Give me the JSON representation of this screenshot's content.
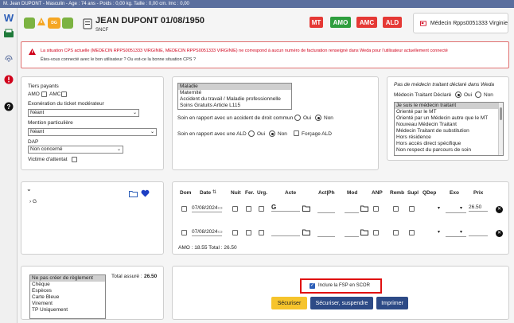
{
  "topbar": {
    "text": "M. Jean DUPONT - Masculin - Age : 74 ans -   Poids : 0,00 kg.  Taille : 0,00 cm.  Imc : 0,00"
  },
  "sidebar": {
    "items": [
      "w-logo-icon",
      "card-reader-icon",
      "fingerprint-icon",
      "alert-icon",
      "help-icon"
    ]
  },
  "patient": {
    "name": "JEAN DUPONT 01/08/1950",
    "org": "SNCF"
  },
  "badges": [
    {
      "label": "MT",
      "color": "#e53935"
    },
    {
      "label": "AMO",
      "color": "#2e9e3e"
    },
    {
      "label": "AMC",
      "color": "#e53935"
    },
    {
      "label": "ALD",
      "color": "#e53935"
    }
  ],
  "doctor": {
    "label": "Médecin Rpps0051333 Virginie"
  },
  "alert": {
    "title": "La situation CPS actuelle (MEDECIN RPPS0051333 VIRGINIE, MEDECIN RPPS0051333 VIRGINIE) ne correspond à aucun numéro de facturation renseigné dans Weda pour l'utilisateur actuellement connecté",
    "sub": "Êtes-vous connecté avec le bon utilisateur ? Ou est-ce la bonne situation CPS ?"
  },
  "left_panel": {
    "tiers_payants": "Tiers payants",
    "amo": "AMO",
    "amc": "AMC",
    "exoneration_label": "Exonération du ticket modérateur",
    "exoneration_value": "Néant",
    "mention_label": "Mention particulière",
    "mention_value": "Néant",
    "dap_label": "DAP",
    "dap_value": "Non concerné",
    "victime_label": "Victime d'attentat"
  },
  "middle_panel": {
    "list": [
      "Maladie",
      "Maternité",
      "Accident du travail / Maladie professionnelle",
      "Soins Gratuits Article L115"
    ],
    "accident_label": "Soin en rapport avec un accident de droit commun",
    "ald_label": "Soin en rapport avec une ALD",
    "oui": "Oui",
    "non": "Non",
    "forcage": "Forçage ALD"
  },
  "right_panel": {
    "title": "Pas de médecin traitant déclaré dans Weda",
    "declare_label": "Médecin Traitant Déclaré",
    "oui": "Oui",
    "non": "Non",
    "list": [
      "Je suis le médecin traitant",
      "Orienté par le MT",
      "Orienté par un Médecin autre que le MT",
      "Nouveau Médecin Traitant",
      "Médecin Traitant de substitution",
      "Hors résidence",
      "Hors accès direct spécifique",
      "Non respect du parcours de soin"
    ]
  },
  "tree": {
    "item": "G"
  },
  "acts_table": {
    "headers": [
      "Dom",
      "Date",
      "Nuit",
      "Fer.",
      "Urg.",
      "Acte",
      "Act|Ph",
      "Mod",
      "ANP",
      "Remb",
      "Supl",
      "QDep",
      "Exo",
      "Prix"
    ],
    "rows": [
      {
        "date": "07/08/2024",
        "acte": "G",
        "prix": "26.50"
      },
      {
        "date": "07/08/2024",
        "acte": "",
        "prix": ""
      }
    ],
    "totals": "AMO : 18.55   Total : 26.50"
  },
  "payment": {
    "list": [
      "Ne pas créer de règlement",
      "Chèque",
      "Espèces",
      "Carte Bleue",
      "Virement",
      "TP Uniquement"
    ],
    "total_label": "Total assuré :",
    "total_value": "26.50"
  },
  "actions": {
    "fsp_label": "Inclure la FSP en SCOR",
    "secure": "Sécuriser",
    "secure_suspend": "Sécuriser, suspendre",
    "print": "Imprimer"
  }
}
